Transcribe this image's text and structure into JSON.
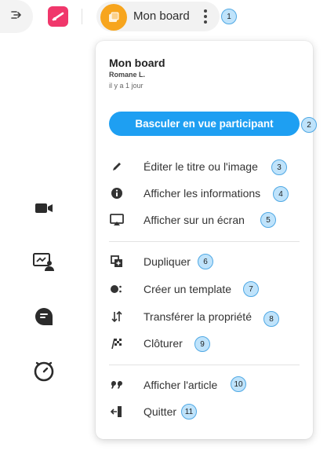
{
  "topbar": {
    "board_name": "Mon board",
    "colors": {
      "logo": "#f0376b",
      "avatar": "#f7a51e"
    },
    "icons": [
      "expand-arrow-icon",
      "app-logo-icon",
      "board-avatar-icon",
      "more-vertical-icon"
    ]
  },
  "badges": [
    "1",
    "2",
    "3",
    "4",
    "5",
    "6",
    "7",
    "8",
    "9",
    "10",
    "11"
  ],
  "rail": {
    "icons": [
      "video-camera-icon",
      "presentation-user-icon",
      "chat-bubble-icon",
      "timer-icon"
    ]
  },
  "menu": {
    "title": "Mon board",
    "author": "Romane L.",
    "date": "il y a 1 jour",
    "primary_button": "Basculer en vue participant",
    "accent_color": "#1e9ff2",
    "items": [
      {
        "label": "Éditer le titre ou l'image",
        "icon": "pencil-icon"
      },
      {
        "label": "Afficher les informations",
        "icon": "info-icon"
      },
      {
        "label": "Afficher sur un écran",
        "icon": "cast-screen-icon"
      },
      {
        "label": "Dupliquer",
        "icon": "duplicate-icon"
      },
      {
        "label": "Créer un template",
        "icon": "template-icon"
      },
      {
        "label": "Transférer la propriété",
        "icon": "transfer-icon"
      },
      {
        "label": "Clôturer",
        "icon": "finish-flag-icon"
      },
      {
        "label": "Afficher l'article",
        "icon": "quote-icon"
      },
      {
        "label": "Quitter",
        "icon": "exit-icon"
      }
    ]
  }
}
